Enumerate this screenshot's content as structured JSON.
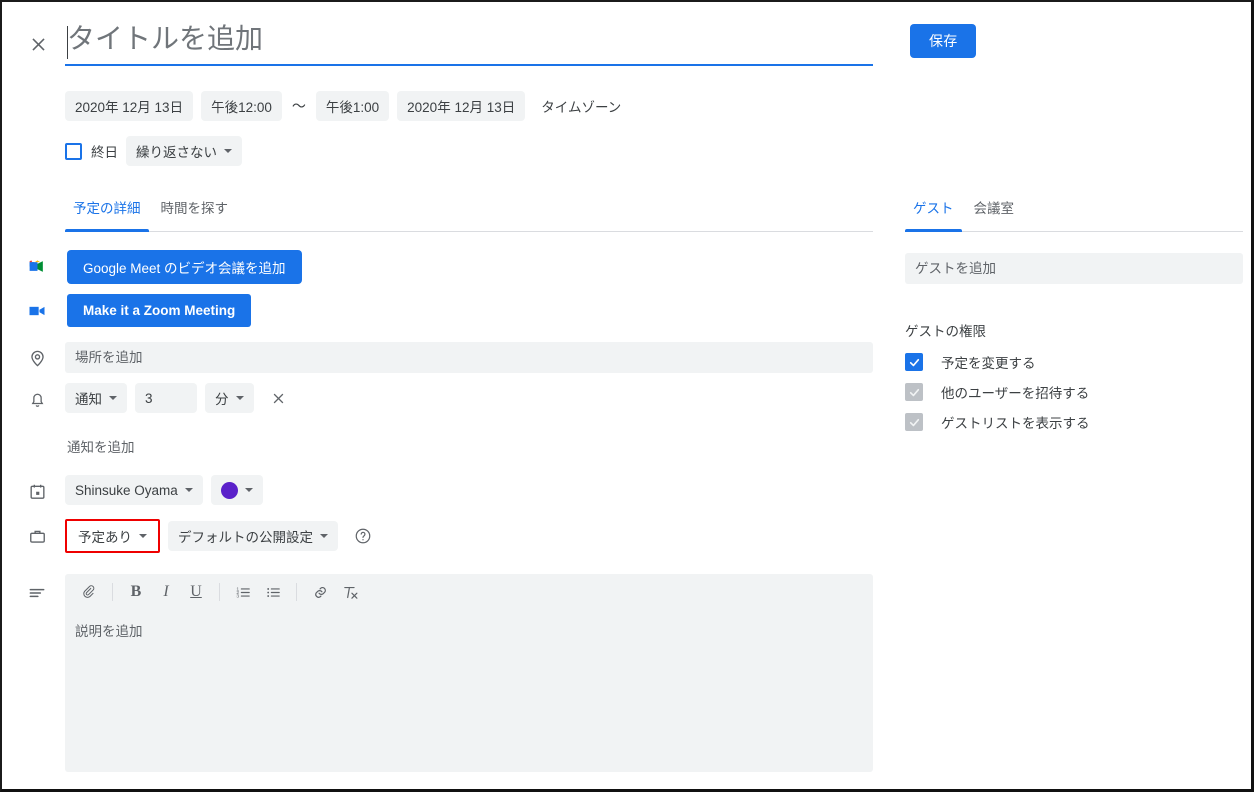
{
  "header": {
    "close_icon": "close-icon",
    "title_placeholder": "タイトルを追加",
    "title_value": "",
    "save_label": "保存"
  },
  "schedule": {
    "start_date": "2020年 12月 13日",
    "start_time": "午後12:00",
    "separator": "〜",
    "end_time": "午後1:00",
    "end_date": "2020年 12月 13日",
    "timezone_label": "タイムゾーン",
    "all_day_label": "終日",
    "all_day_checked": false,
    "repeat_label": "繰り返さない"
  },
  "left_tabs": [
    {
      "label": "予定の詳細",
      "active": true
    },
    {
      "label": "時間を探す",
      "active": false
    }
  ],
  "conferencing": {
    "meet_icon": "google-meet-icon",
    "meet_label": "Google Meet のビデオ会議を追加",
    "zoom_icon": "video-camera-icon",
    "zoom_label": "Make it a Zoom Meeting"
  },
  "location": {
    "icon": "location-pin-icon",
    "placeholder": "場所を追加",
    "value": ""
  },
  "notification": {
    "icon": "bell-icon",
    "type_label": "通知",
    "amount": "3",
    "unit_label": "分",
    "remove_icon": "close-icon",
    "add_label": "通知を追加"
  },
  "calendar": {
    "icon": "calendar-icon",
    "owner": "Shinsuke Oyama",
    "color_hex": "#5B21CA",
    "color_icon": "color-swatch-icon"
  },
  "availability": {
    "icon": "briefcase-icon",
    "busy_label": "予定あり",
    "highlight_color": "#ef0000",
    "visibility_label": "デフォルトの公開設定",
    "help_icon": "help-circle-icon"
  },
  "description": {
    "icon": "description-lines-icon",
    "placeholder": "説明を追加",
    "value": "",
    "toolbar": [
      {
        "name": "attach-icon",
        "glyph": "attach"
      },
      {
        "name": "bold-icon",
        "glyph": "B"
      },
      {
        "name": "italic-icon",
        "glyph": "I"
      },
      {
        "name": "underline-icon",
        "glyph": "U"
      },
      {
        "name": "numbered-list-icon",
        "glyph": "ol"
      },
      {
        "name": "bulleted-list-icon",
        "glyph": "ul"
      },
      {
        "name": "link-icon",
        "glyph": "link"
      },
      {
        "name": "clear-formatting-icon",
        "glyph": "clear"
      }
    ]
  },
  "right_panel": {
    "tabs": [
      {
        "label": "ゲスト",
        "active": true
      },
      {
        "label": "会議室",
        "active": false
      }
    ],
    "guest_input_placeholder": "ゲストを追加",
    "guest_input_value": "",
    "permissions_title": "ゲストの権限",
    "permissions": [
      {
        "label": "予定を変更する",
        "checked": true,
        "enabled": true
      },
      {
        "label": "他のユーザーを招待する",
        "checked": true,
        "enabled": false
      },
      {
        "label": "ゲストリストを表示する",
        "checked": true,
        "enabled": false
      }
    ]
  },
  "colors": {
    "accent_blue": "#1a73e8",
    "chip_bg": "#f1f3f4",
    "text_primary": "#3c4043",
    "text_secondary": "#5f6368"
  }
}
